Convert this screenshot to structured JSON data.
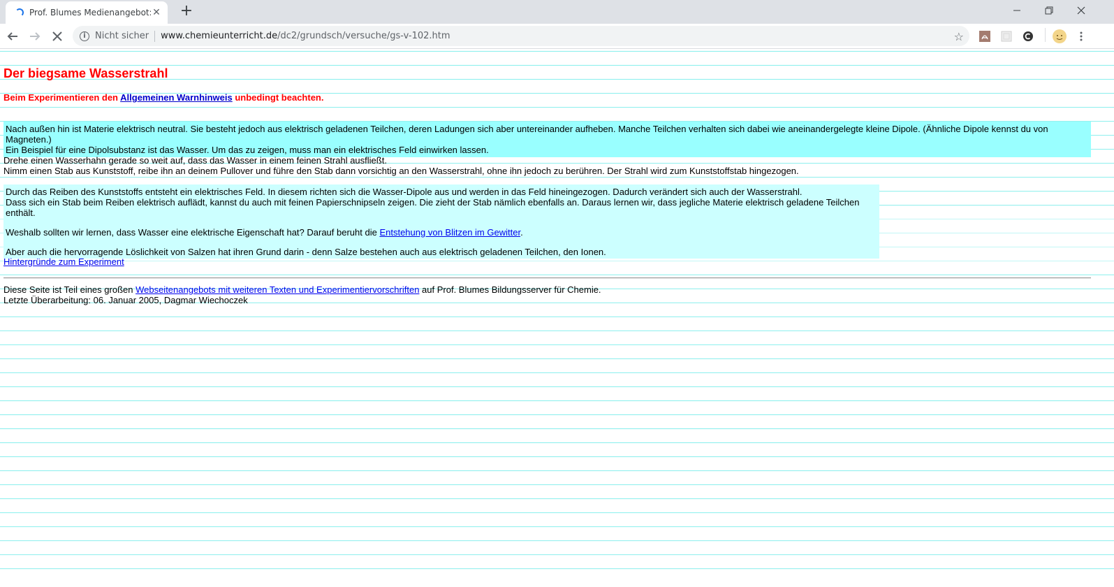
{
  "browser": {
    "tab_title": "Prof. Blumes Medienangebot: Ch",
    "not_secure_label": "Nicht sicher",
    "url_host": "www.chemieunterricht.de",
    "url_path": "/dc2/grundsch/versuche/gs-v-102.htm"
  },
  "page": {
    "title": "Der biegsame Wasserstrahl",
    "warning": {
      "prefix": "Beim Experimentieren den ",
      "link": "Allgemeinen Warnhinweis",
      "suffix": " unbedingt beachten."
    },
    "intro_box": {
      "line1": "Nach außen hin ist Materie elektrisch neutral. Sie besteht jedoch aus elektrisch geladenen Teilchen, deren Ladungen sich aber untereinander aufheben. Manche Teilchen verhalten sich dabei wie aneinandergelegte kleine Dipole. (Ähnliche Dipole kennst du von Magneten.)",
      "line2": "Ein Beispiel für eine Dipolsubstanz ist das Wasser. Um das zu zeigen, muss man ein elektrisches Feld einwirken lassen."
    },
    "instructions": {
      "line1": "Drehe einen Wasserhahn gerade so weit auf, dass das Wasser in einem feinen Strahl ausfließt.",
      "line2": "Nimm einen Stab aus Kunststoff, reibe ihn an deinem Pullover und führe den Stab dann vorsichtig an den Wasserstrahl, ohne ihn jedoch zu berühren. Der Strahl wird zum Kunststoffstab hingezogen."
    },
    "explanation_box": {
      "line1": "Durch das Reiben des Kunststoffs entsteht ein elektrisches Feld. In diesem richten sich die Wasser-Dipole aus und werden in das Feld hineingezogen. Dadurch verändert sich auch der Wasserstrahl.",
      "line2": "Dass sich ein Stab beim Reiben elektrisch auflädt, kannst du auch mit feinen Papierschnipseln zeigen. Die zieht der Stab nämlich ebenfalls an. Daraus lernen wir, dass jegliche Materie elektrisch geladene Teilchen enthält.",
      "question_prefix": "Weshalb sollten wir lernen, dass Wasser eine elektrische Eigenschaft hat? Darauf beruht die ",
      "question_link": "Entstehung von Blitzen im Gewitter",
      "question_suffix": ".",
      "salts": "Aber auch die hervorragende Löslichkeit von Salzen hat ihren Grund darin - denn Salze bestehen auch aus elektrisch geladenen Teilchen, den Ionen."
    },
    "background_link": "Hintergründe zum Experiment",
    "footer": {
      "prefix": "Diese Seite ist Teil eines großen ",
      "link": "Webseitenangebots mit weiteren Texten und Experimentiervorschriften",
      "suffix": " auf Prof. Blumes Bildungsserver für Chemie.",
      "revision": "Letzte Überarbeitung: 06. Januar 2005, Dagmar Wiechoczek"
    }
  },
  "colors": {
    "title_red": "#ff0000",
    "intro_box_bg": "#99ffff",
    "explanation_box_bg": "#ccffff",
    "ruled_line": "#8ff0ee"
  },
  "icons": [
    "loading-spinner-icon",
    "close-icon",
    "plus-icon",
    "minimize-icon",
    "restore-icon",
    "back-arrow-icon",
    "forward-arrow-icon",
    "stop-icon",
    "info-icon",
    "star-icon",
    "pdf-extension-icon",
    "extension-icon",
    "c-extension-icon",
    "profile-avatar-icon",
    "kebab-menu-icon"
  ]
}
